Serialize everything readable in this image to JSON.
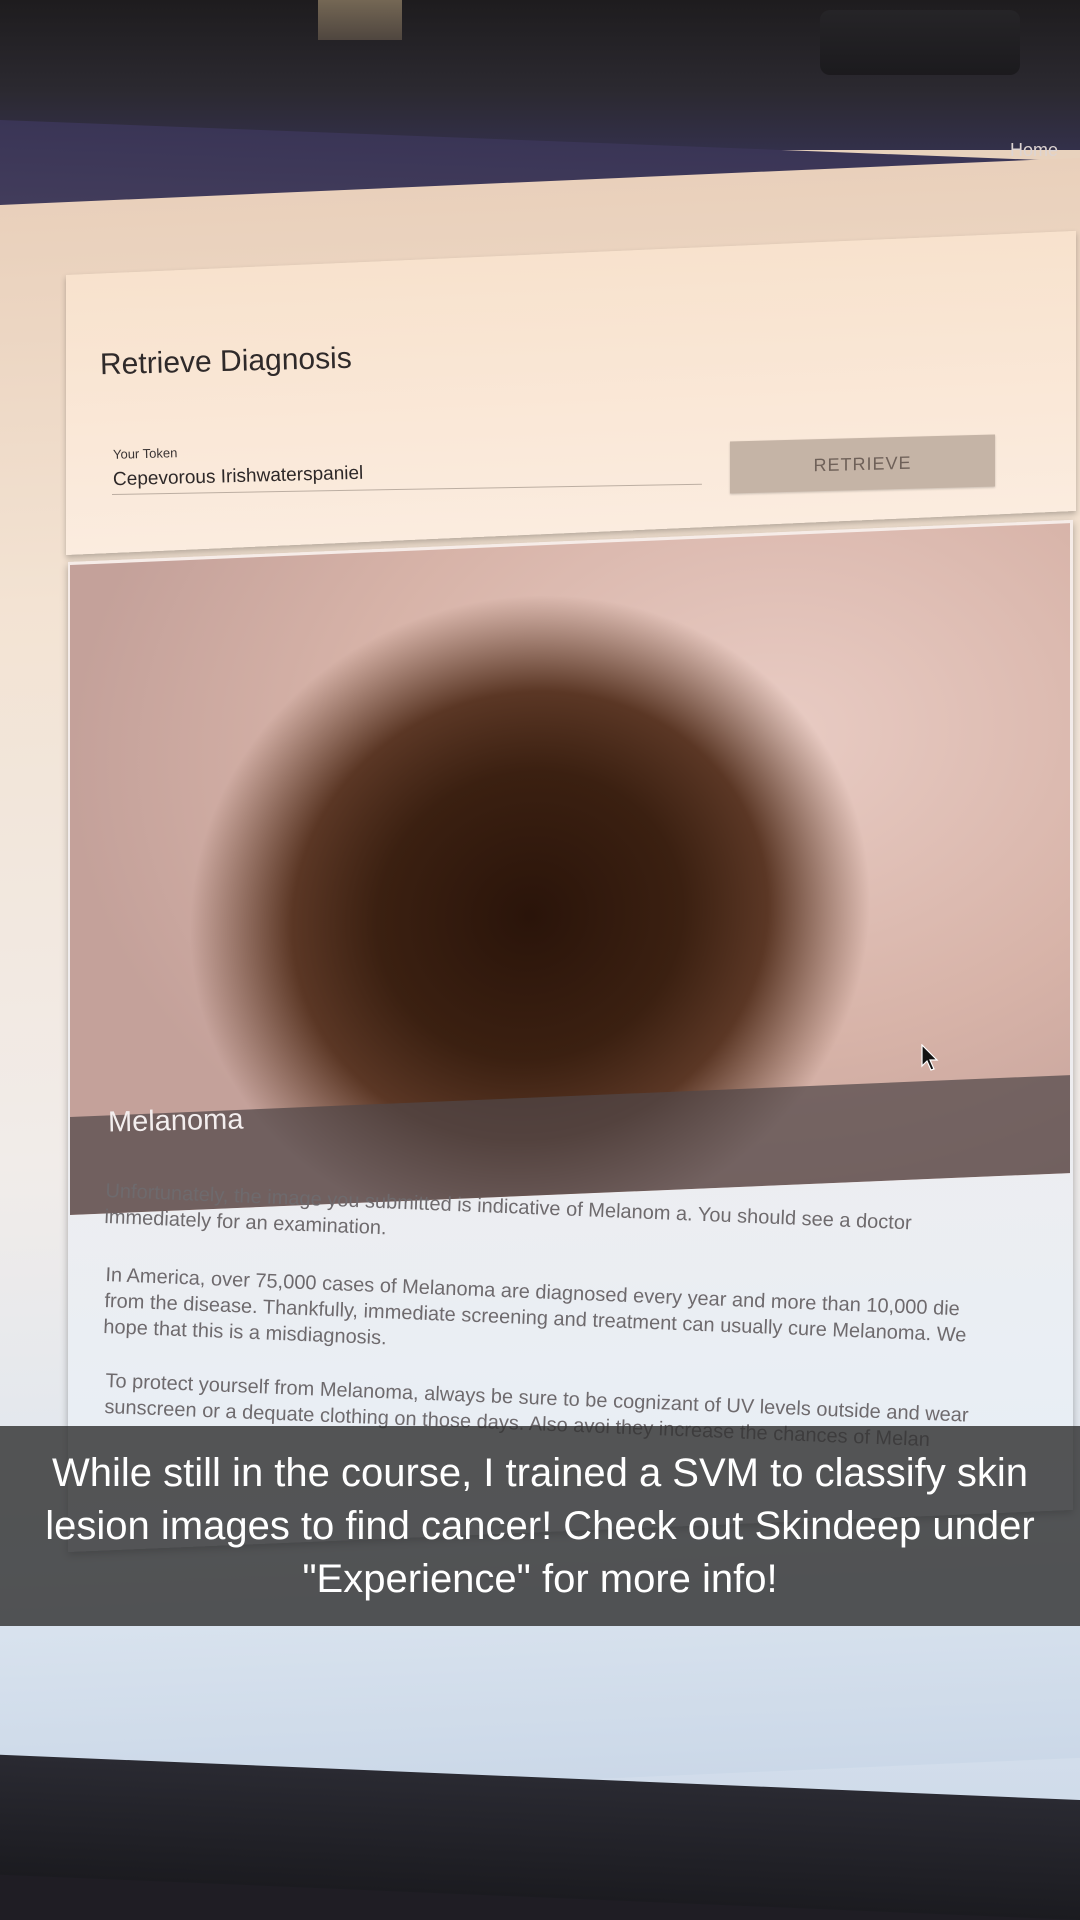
{
  "nav": {
    "home_label": "Home"
  },
  "retrieve": {
    "title": "Retrieve Diagnosis",
    "token_label": "Your Token",
    "token_value": "Cepevorous Irishwaterspaniel",
    "button_label": "RETRIEVE"
  },
  "result": {
    "diagnosis": "Melanoma",
    "paragraphs": [
      "Unfortunately, the image you submitted is indicative of Melanom a. You should see a doctor immediately for an examination.",
      "In America, over 75,000 cases of Melanoma are diagnosed every year and more than 10,000 die from the disease. Thankfully, immediate screening and treatment can usually cure Melanoma. We hope that this is a misdiagnosis.",
      "To protect yourself from Melanoma, always be sure to be cognizant of UV levels outside and wear sunscreen or a dequate clothing on those days. Also avoi they increase the chances of Melan"
    ]
  },
  "caption": {
    "text": "While still in the course, I trained a SVM to classify skin lesion images to find cancer! Check out Skindeep under \"Experience\" for more info!"
  },
  "colors": {
    "navbar": "#3a3556",
    "button_bg": "#c5b4a6",
    "caption_bg": "#323232"
  }
}
